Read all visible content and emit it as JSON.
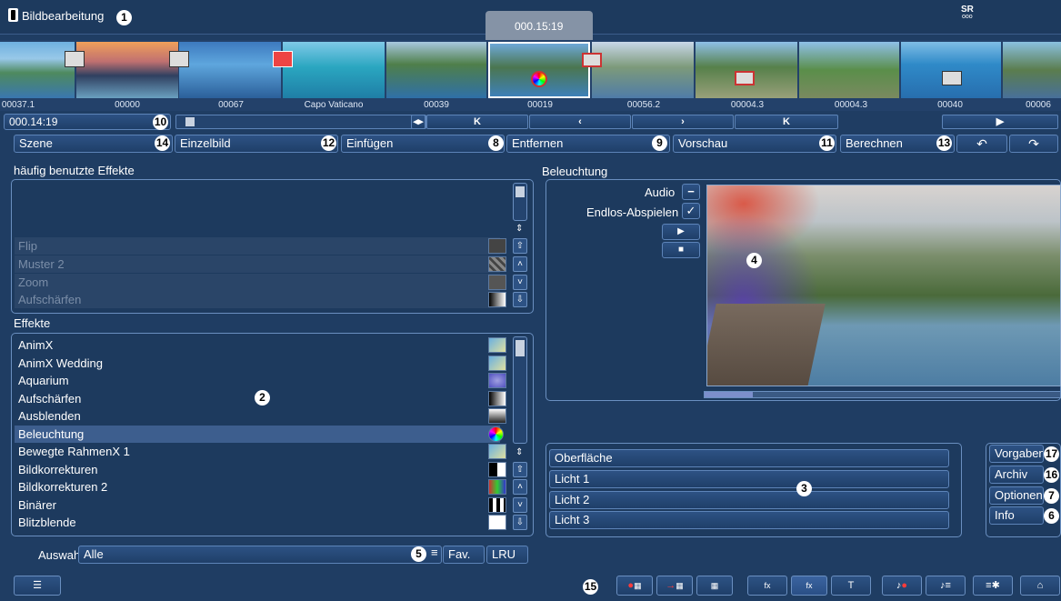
{
  "header": {
    "title": "Bildbearbeitung",
    "logo": "SR",
    "logo_sub": "ooo",
    "current_time": "000.15:19"
  },
  "timeline": {
    "labels": [
      "00037.1",
      "00000",
      "00067",
      "Capo Vaticano",
      "00039",
      "00019",
      "00056.2",
      "00004.3",
      "00004.3",
      "00040",
      "00006"
    ],
    "position": "000.14:19",
    "transport": {
      "fit": "◂▸",
      "first": "K",
      "prev": "‹",
      "next": "›",
      "last": "K",
      "play": "▶"
    }
  },
  "toolbar": {
    "scene": "Szene",
    "single_frame": "Einzelbild",
    "insert": "Einfügen",
    "remove": "Entfernen",
    "preview": "Vorschau",
    "calculate": "Berechnen",
    "undo_icon": "undo-icon",
    "redo_icon": "redo-icon"
  },
  "favorites": {
    "title": "häufig benutzte Effekte",
    "items": [
      "Flip",
      "Muster 2",
      "Zoom",
      "Aufschärfen"
    ]
  },
  "effects": {
    "title": "Effekte",
    "items": [
      "AnimX",
      "AnimX Wedding",
      "Aquarium",
      "Aufschärfen",
      "Ausblenden",
      "Beleuchtung",
      "Bewegte RahmenX 1",
      "Bildkorrekturen",
      "Bildkorrekturen 2",
      "Binärer",
      "Blitzblende"
    ],
    "selected": "Beleuchtung"
  },
  "selection": {
    "label": "Auswahl",
    "value": "Alle",
    "fav": "Fav.",
    "lru": "LRU"
  },
  "preview": {
    "title": "Beleuchtung",
    "audio": "Audio",
    "loop": "Endlos-Abspielen",
    "audio_mark": "−",
    "loop_mark": "✓",
    "play": "▶",
    "stop": "■"
  },
  "params": {
    "items": [
      "Oberfläche",
      "Licht 1",
      "Licht 2",
      "Licht 3"
    ]
  },
  "side": {
    "presets": "Vorgaben",
    "archive": "Archiv",
    "options": "Optionen",
    "info": "Info"
  },
  "numbers": [
    "1",
    "2",
    "3",
    "4",
    "5",
    "6",
    "7",
    "8",
    "9",
    "10",
    "11",
    "12",
    "13",
    "14",
    "15",
    "16",
    "17"
  ],
  "colors": {
    "background": "#1f3d63",
    "accent": "#ff3b3b",
    "border": "#6a8fc0"
  }
}
